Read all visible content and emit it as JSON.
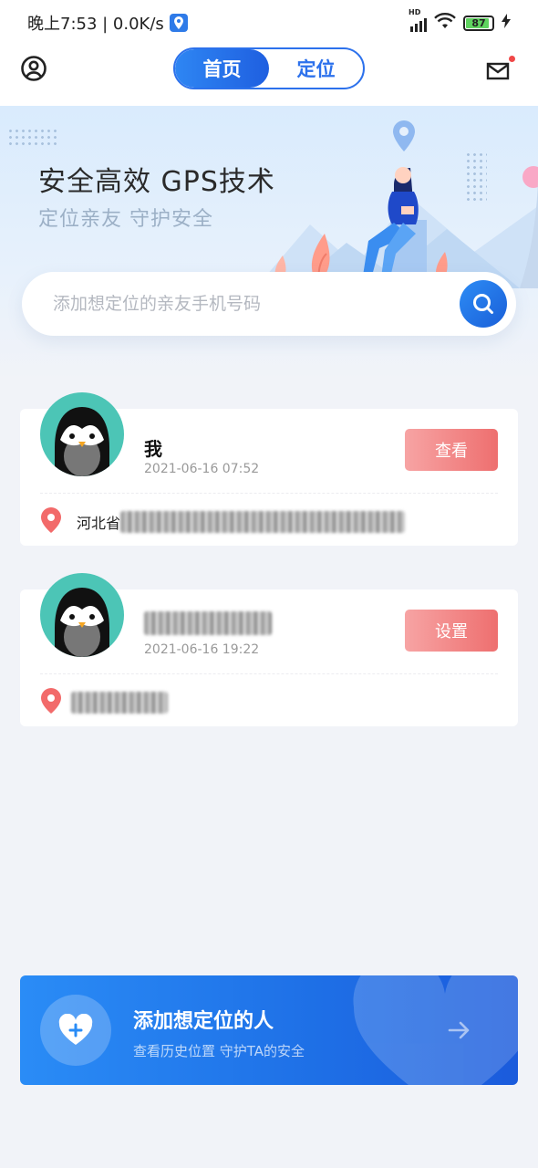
{
  "status_bar": {
    "time": "晚上7:53 | 0.0K/s",
    "network": "HD",
    "battery": "87"
  },
  "header": {
    "tabs": [
      {
        "label": "首页",
        "active": true
      },
      {
        "label": "定位",
        "active": false
      }
    ],
    "accent_color": "#2c71ec"
  },
  "banner": {
    "title": "安全高效  GPS技术",
    "subtitle": "定位亲友  守护安全"
  },
  "search": {
    "placeholder": "添加想定位的亲友手机号码"
  },
  "contacts": [
    {
      "name": "我",
      "time": "2021-06-16 07:52",
      "action": "查看",
      "location": "河北省"
    },
    {
      "name": "",
      "time": "2021-06-16 19:22",
      "action": "设置",
      "location": ""
    }
  ],
  "cta": {
    "title": "添加想定位的人",
    "subtitle": "查看历史位置 守护TA的安全"
  }
}
